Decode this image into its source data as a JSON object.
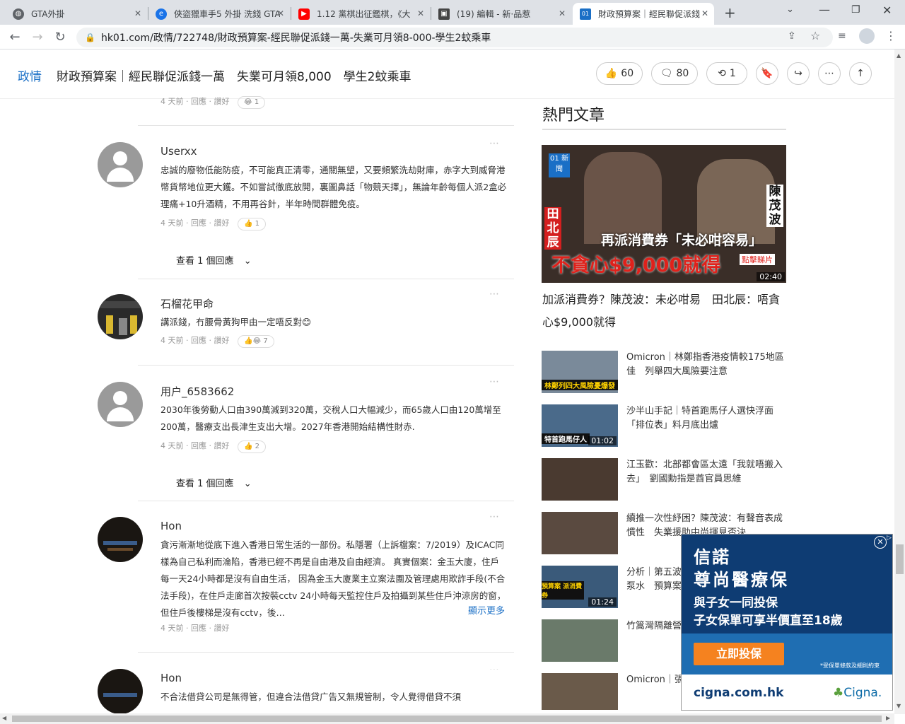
{
  "browser": {
    "tabs": [
      {
        "title": "GTA外掛",
        "active": false
      },
      {
        "title": "俠盜獵車手5 外掛 洗錢 GTA",
        "active": false
      },
      {
        "title": "1.12 黨棋出征鑑棋，《大",
        "active": false
      },
      {
        "title": "(19) 編輯 - 新·品惹",
        "active": false
      },
      {
        "title": "財政預算案｜經民聯促派錢",
        "active": true
      }
    ],
    "new_tab": "+",
    "url": "hk01.com/政情/722748/財政預算案-經民聯促派錢一萬-失業可月領8-000-學生2蚊乘車"
  },
  "header": {
    "category": "政情",
    "title": "財政預算案｜經民聯促派錢一萬　失業可月領8,000　學生2蚊乘車",
    "likes": "60",
    "comments": "80",
    "shares": "1"
  },
  "comments": [
    {
      "meta_time": "4 天前",
      "reply": "回應",
      "like": "讚好",
      "reaction": "1"
    },
    {
      "user": "Userxx",
      "body": "忠誠的廢物低能防疫，不可能真正清零，通關無望，又要頻繁洗劫財庫，赤字大到威脅港幣貨幣地位更大鑊。不如嘗試徹底放開，裏圖鼻話「物競天擇」，無論年齡每個人派2盒必理痛+10升酒精，不用再谷針，半年時間群體免疫。",
      "meta_time": "4 天前",
      "reply": "回應",
      "like": "讚好",
      "reaction": "1",
      "view_replies": "查看 1 個回應"
    },
    {
      "user": "石榴花甲命",
      "body": "講派錢，冇腰骨黃狗甲由一定唔反對😊",
      "meta_time": "4 天前",
      "reply": "回應",
      "like": "讚好",
      "reaction": "7"
    },
    {
      "user": "用户_6583662",
      "body": "2030年後勞動人口由390萬減到320萬，交稅人口大幅減少，而65歲人口由120萬增至200萬，醫療支出長津生支出大增。2027年香港開始結構性財赤.",
      "meta_time": "4 天前",
      "reply": "回應",
      "like": "讚好",
      "reaction": "2",
      "view_replies": "查看 1 個回應"
    },
    {
      "user": "Hon",
      "body": "貪污漸漸地從底下進入香港日常生活的一部份。私隱署（上訴檔案：7/2019）及ICAC同樣為自己私利而淪陷，香港已經不再是自由港及自由經濟。 真實個案：金玉大廈，住戶每一天24小時都是沒有自由生活， 因為金玉大廈業主立案法團及管理處用欺詐手段(不合法手段)，在住戶走廊首次按裝cctv 24小時每天監控住戶及拍攝到某些住戶沖涼房的窗， 但住戶後樓梯是沒有cctv，後…",
      "more": "顯示更多",
      "meta_time": "4 天前",
      "reply": "回應",
      "like": "讚好"
    },
    {
      "user": "Hon",
      "body": "不合法借貸公司是無得管，但違合法借貸广告又無規管制，令人覺得借貸不須"
    }
  ],
  "sidebar": {
    "title": "熱門文章",
    "hero": {
      "title": "加派消費券？陳茂波：未必咁易　田北辰：唔貪心$9,000就得",
      "logo": "01 新聞",
      "overlay_top": "再派消費券「未必咁容易」",
      "overlay_bottom": "不貪心$9,000就得",
      "left_name": "田北辰",
      "right_name": "陳茂波",
      "click": "點擊睇片",
      "duration": "02:40"
    },
    "items": [
      {
        "title": "Omicron｜林鄭指香港疫情較175地區佳　列舉四大風險要注意",
        "thumb_text": "林鄭列四大風險憂爆發",
        "duration": ""
      },
      {
        "title": "沙半山手記｜特首跑馬仔人選快浮面　「排位表」料月底出爐",
        "thumb_text": "特首跑馬仔人",
        "duration": "01:02"
      },
      {
        "title": "江玉歡：北部都會區太遠「我就唔搬入去」　劉國勳指是酋官員思維",
        "thumb_text": "",
        "duration": ""
      },
      {
        "title": "續推一次性紓困？陳茂波：有聲音表成慣性　失業援助中尚揮見否決",
        "thumb_text": "",
        "duration": ""
      },
      {
        "title": "分析｜第五波疫情來勢洶洶　政府財政泵水　預算案會否派錢",
        "thumb_text": "預算案 派消費券",
        "duration": "01:24"
      },
      {
        "title": "竹篙灣隔離營　政府改善檢疫中心",
        "thumb_text": "",
        "duration": ""
      },
      {
        "title": "Omicron｜張竹君：林鄭：市民配合",
        "thumb_text": "",
        "duration": ""
      }
    ]
  },
  "ad": {
    "brand_cn": "信諾",
    "headline": "尊尚醫療保",
    "line1": "與子女一同投保",
    "line2": "子女保單可享半價直至18歲",
    "cta": "立即投保",
    "fine": "*受保單條款及細則約束",
    "site": "cigna.com.hk",
    "logo": "Cigna."
  },
  "colors": {
    "accent": "#1a6fc6",
    "ad_blue": "#0e3c73",
    "ad_orange": "#f5821f"
  }
}
